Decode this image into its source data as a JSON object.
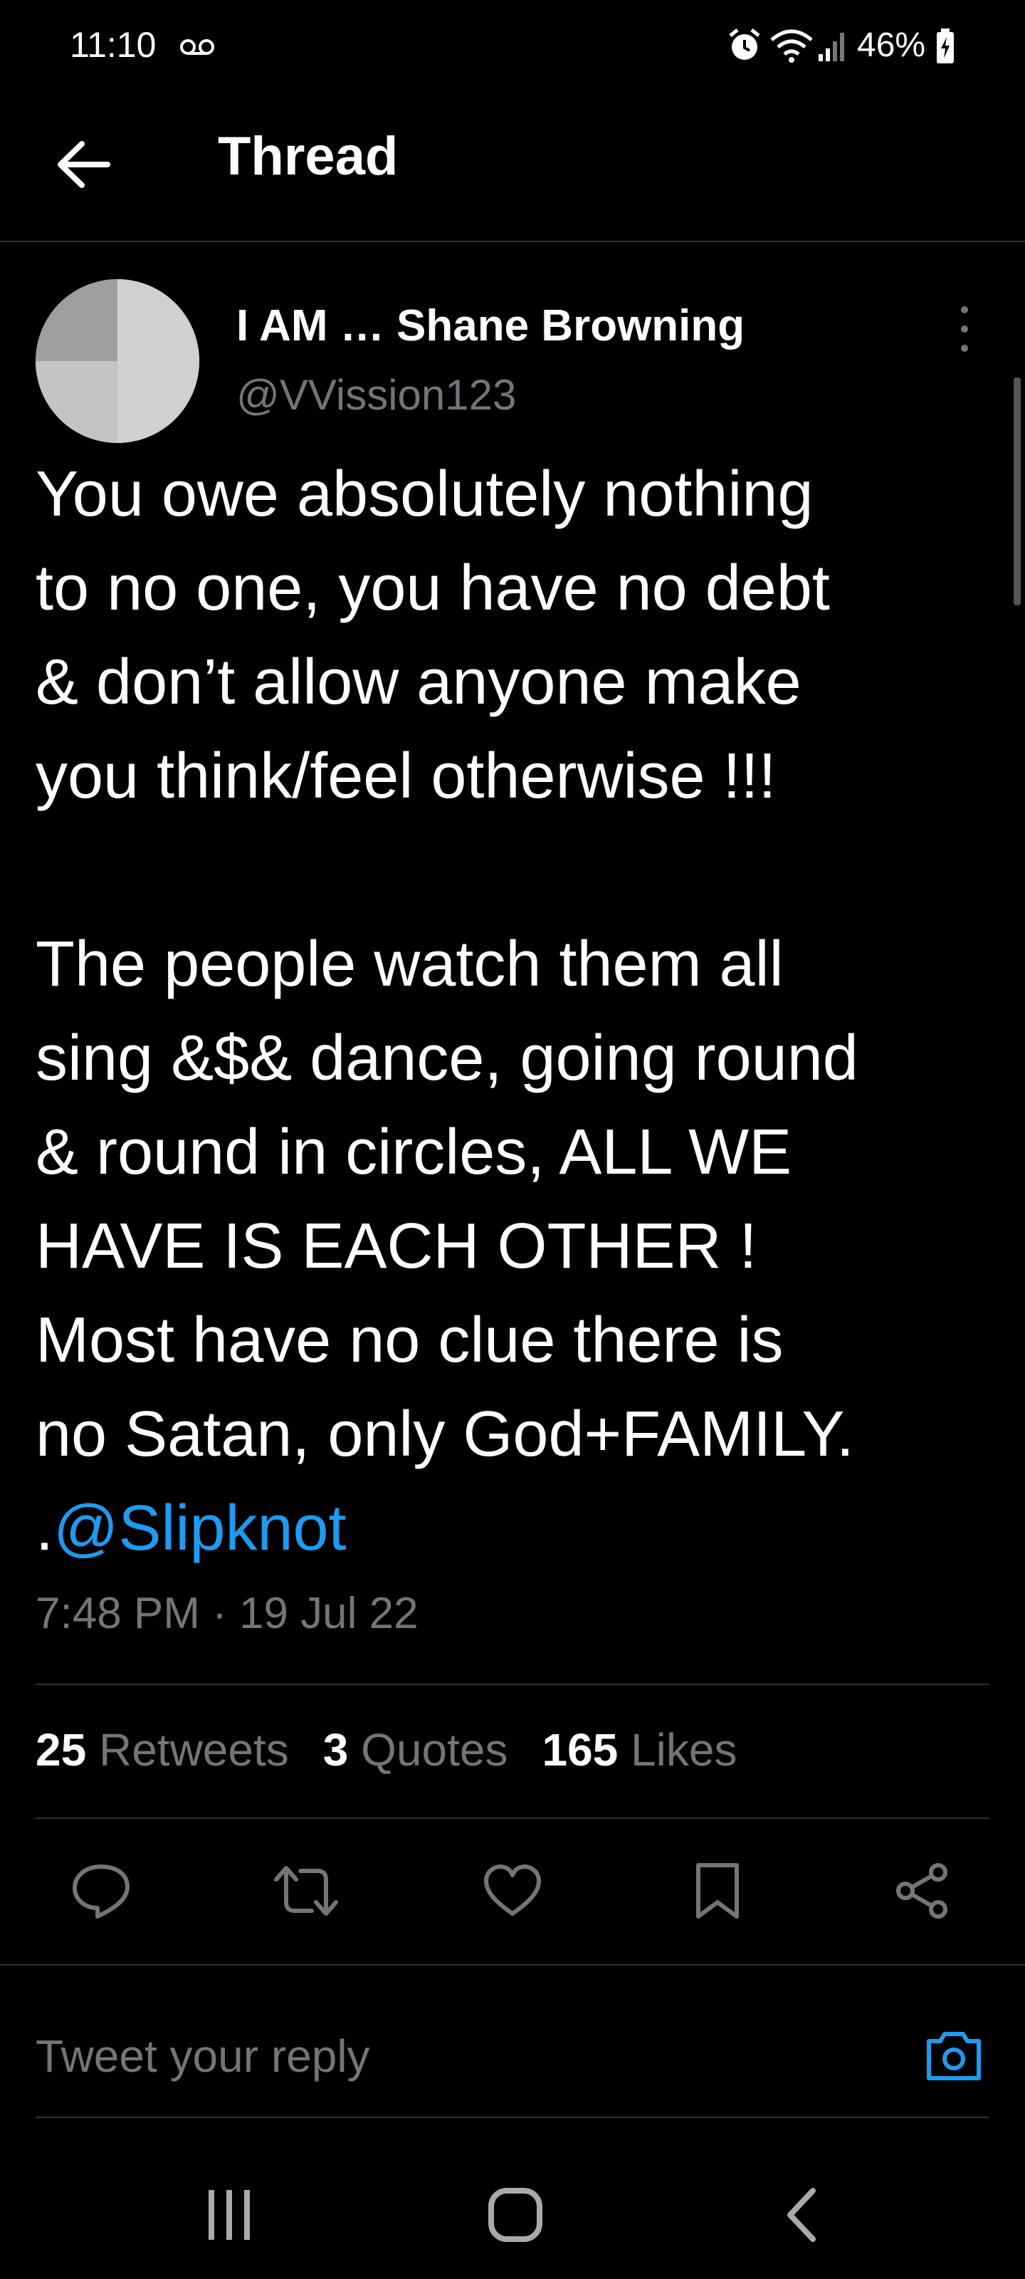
{
  "status_bar": {
    "time": "11:10",
    "battery": "46%",
    "icons": [
      "voicemail-icon",
      "alarm-icon",
      "wifi-icon",
      "signal-icon",
      "battery-charging-icon"
    ]
  },
  "header": {
    "title": "Thread",
    "back_icon": "arrow-left-icon"
  },
  "tweet": {
    "author": {
      "display_name": "I AM … Shane Browning",
      "handle": "@VVission123"
    },
    "text_lines_1": [
      "You owe absolutely nothing",
      "to no one, you have no debt",
      "& don’t allow anyone make",
      "you think/feel otherwise !!!"
    ],
    "text_lines_2": [
      "The people watch them all",
      "sing &$& dance, going round",
      "& round in circles, ALL WE",
      "HAVE IS EACH OTHER !",
      "Most have no clue there is",
      "no Satan, only God+FAMILY."
    ],
    "mention_prefix": ".",
    "mention": "@Slipknot",
    "timestamp": "7:48 PM · 19 Jul 22",
    "stats": {
      "retweets_count": "25",
      "retweets_label": "Retweets",
      "quotes_count": "3",
      "quotes_label": "Quotes",
      "likes_count": "165",
      "likes_label": "Likes"
    },
    "actions": [
      "reply-icon",
      "retweet-icon",
      "like-icon",
      "bookmark-icon",
      "share-icon"
    ]
  },
  "reply": {
    "placeholder": "Tweet your reply",
    "camera_icon": "camera-icon"
  },
  "colors": {
    "background": "#000000",
    "accent": "#1d9bf0",
    "muted": "#71767b",
    "divider": "#2f3336"
  }
}
